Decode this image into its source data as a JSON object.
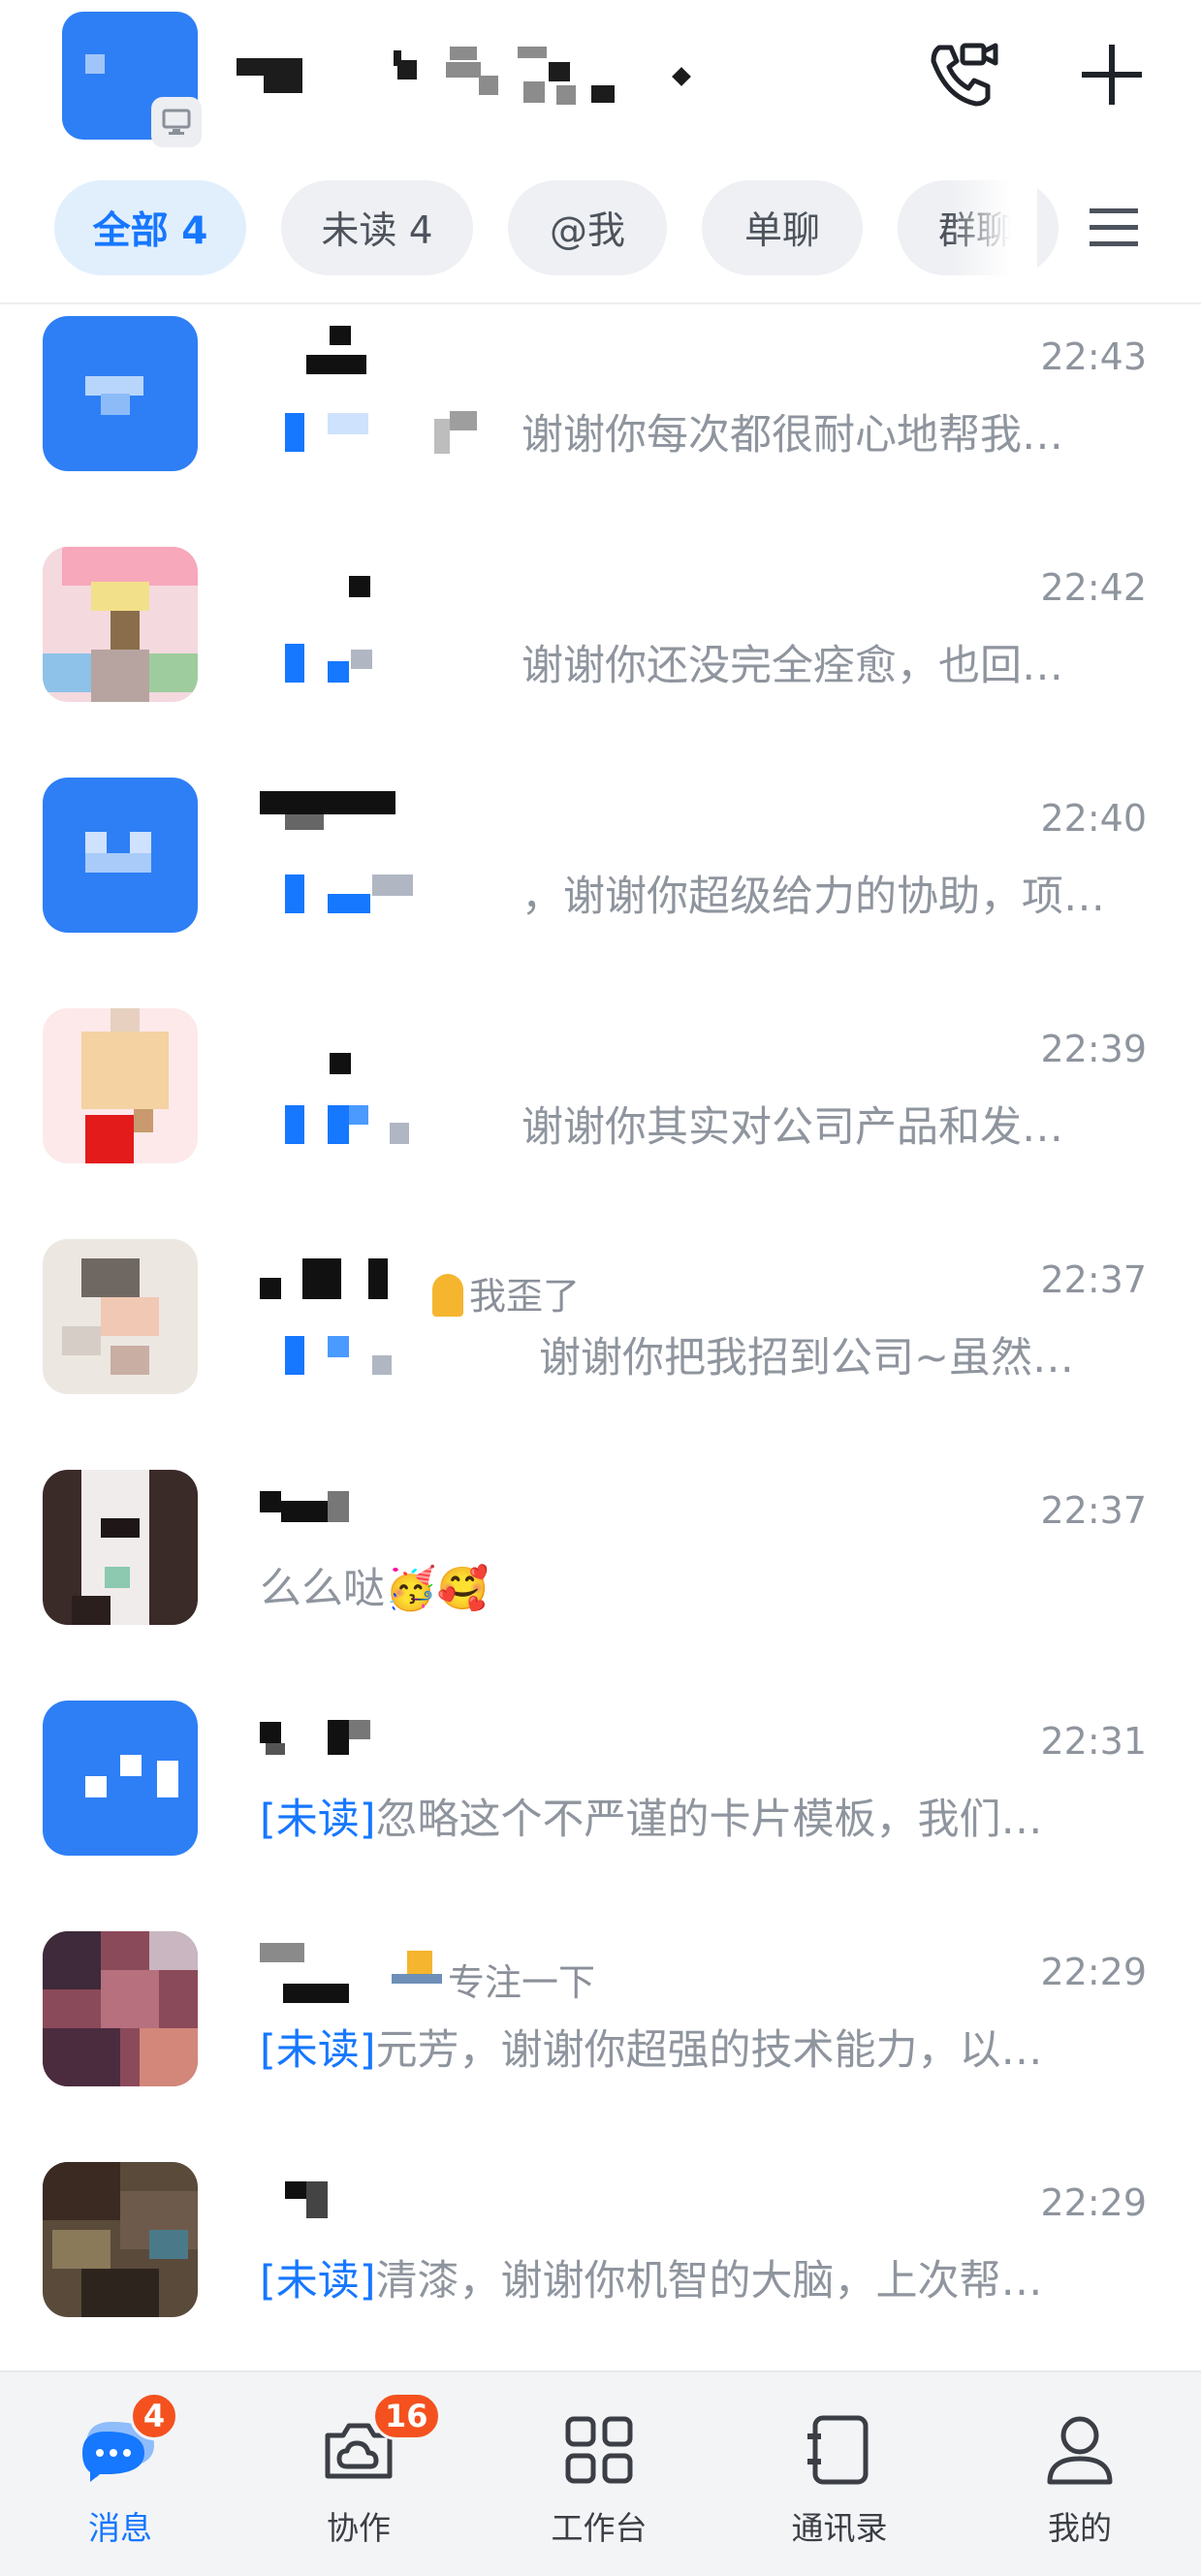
{
  "tabs": [
    "全部 4",
    "未读 4",
    "@我",
    "单聊",
    "群聊"
  ],
  "colors": {
    "accent": "#1677ff",
    "badge": "#f4511e",
    "muted": "#8f959e"
  },
  "header": {
    "icons": [
      "desktop-icon",
      "video-call-icon",
      "plus-icon",
      "menu-icon"
    ]
  },
  "chats": [
    {
      "time": "22:43",
      "status": "",
      "preview": "谢谢你每次都很耐心地帮我…",
      "tag": ""
    },
    {
      "time": "22:42",
      "status": "",
      "preview": "谢谢你还没完全痊愈，也回…",
      "tag": ""
    },
    {
      "time": "22:40",
      "status": "",
      "preview": "，谢谢你超级给力的协助，项…",
      "tag": ""
    },
    {
      "time": "22:39",
      "status": "",
      "preview": "谢谢你其实对公司产品和发…",
      "tag": ""
    },
    {
      "time": "22:37",
      "status": "我歪了",
      "preview": "谢谢你把我招到公司~虽然…",
      "tag": ""
    },
    {
      "time": "22:37",
      "status": "",
      "preview": "么么哒🥳🥰",
      "tag": ""
    },
    {
      "time": "22:31",
      "status": "",
      "preview": "忽略这个不严谨的卡片模板，我们…",
      "tag": "[未读]"
    },
    {
      "time": "22:29",
      "status": "专注一下",
      "preview": "元芳，谢谢你超强的技术能力，以…",
      "tag": "[未读]"
    },
    {
      "time": "22:29",
      "status": "",
      "preview": "清漆，谢谢你机智的大脑，上次帮…",
      "tag": "[未读]"
    }
  ],
  "nav": [
    {
      "label": "消息",
      "badge": "4",
      "icon": "message-icon"
    },
    {
      "label": "协作",
      "badge": "16",
      "icon": "collaboration-icon"
    },
    {
      "label": "工作台",
      "badge": "",
      "icon": "workbench-icon"
    },
    {
      "label": "通讯录",
      "badge": "",
      "icon": "contacts-icon"
    },
    {
      "label": "我的",
      "badge": "",
      "icon": "profile-icon"
    }
  ]
}
